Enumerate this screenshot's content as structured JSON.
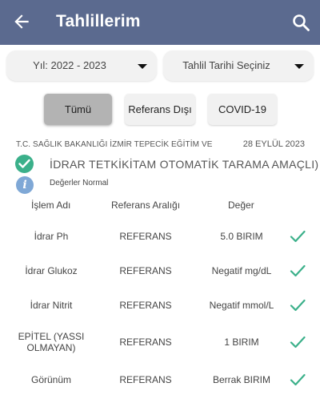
{
  "appbar": {
    "title": "Tahlillerim",
    "back_icon": "arrow-left-icon",
    "search_icon": "search-icon",
    "color": "#5b6a8f"
  },
  "filters": {
    "year": "Yıl: 2022 - 2023",
    "date": "Tahlil Tarihi Seçiniz"
  },
  "chips": {
    "all": "Tümü",
    "out_of_range": "Referans Dışı",
    "covid": "COVID-19",
    "selected": "all"
  },
  "report": {
    "hospital": "T.C. SAĞLIK BAKANLIĞI İZMİR TEPECİK EĞİTİM VE",
    "date": "28 EYLÜL 2023",
    "test_title": "İDRAR TETKİKİTAM OTOMATİK TARAMA AMAÇLI)",
    "status_note": "Değerler Normal",
    "status_icon": "check-circle-icon",
    "info_icon": "info-icon"
  },
  "table": {
    "headers": {
      "name": "İşlem Adı",
      "range": "Referans Aralığı",
      "value": "Değer"
    },
    "rows": [
      {
        "name": "İdrar Ph",
        "range": "REFERANS",
        "value": "5.0 BIRIM",
        "status": "normal"
      },
      {
        "name": "İdrar Glukoz",
        "range": "REFERANS",
        "value": "Negatif mg/dL",
        "status": "normal"
      },
      {
        "name": "İdrar Nitrit",
        "range": "REFERANS",
        "value": "Negatif mmol/L",
        "status": "normal"
      },
      {
        "name": "EPİTEL (YASSI OLMAYAN)",
        "range": "REFERANS",
        "value": "1 BIRIM",
        "status": "normal"
      },
      {
        "name": "Görünüm",
        "range": "REFERANS",
        "value": "Berrak BIRIM",
        "status": "normal"
      }
    ]
  },
  "colors": {
    "accent": "#3bb08a",
    "info": "#7fa8d6",
    "chip_active": "#b3b3b3"
  }
}
